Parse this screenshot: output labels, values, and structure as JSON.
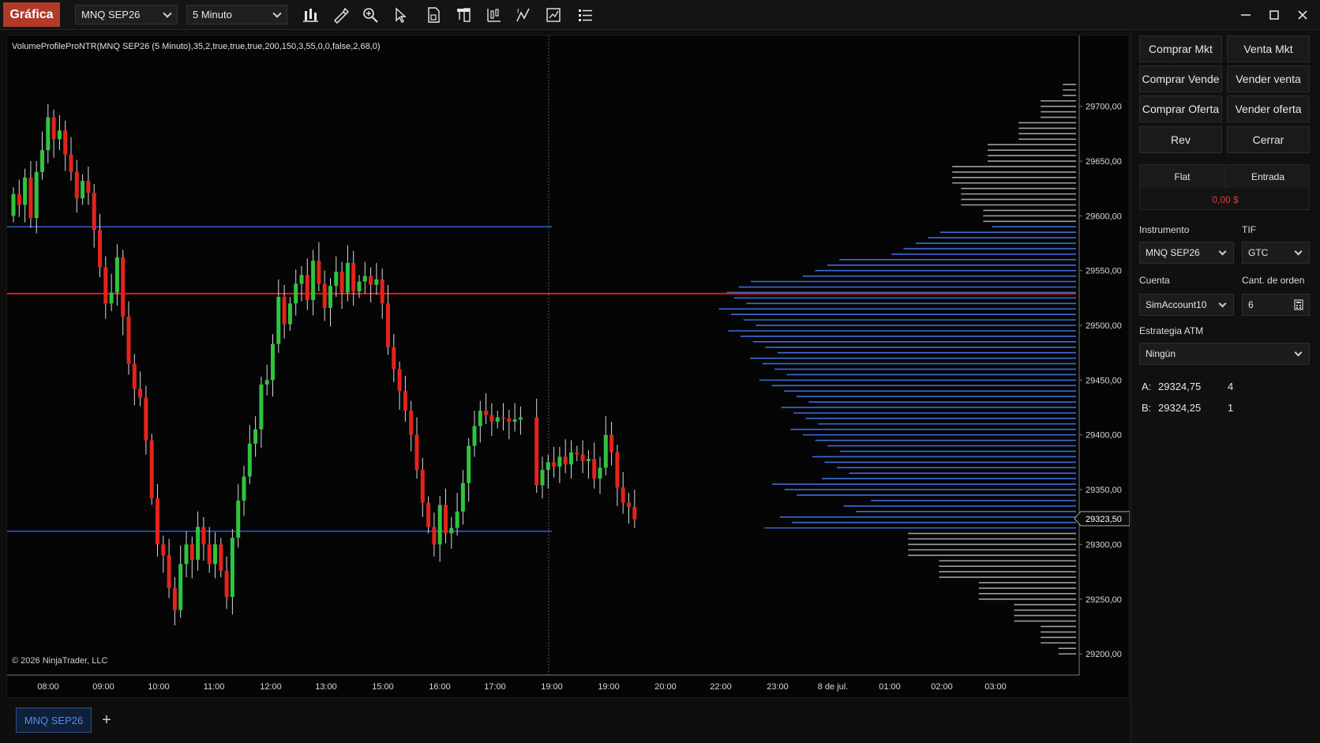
{
  "toolbar": {
    "app_label": "Gráfica",
    "instrument": "MNQ SEP26",
    "interval": "5 Minuto",
    "tools": [
      "bar-type-icon",
      "drawing-tools-icon",
      "zoom-icon",
      "pointer-icon",
      "data-box-icon",
      "chart-trader-icon",
      "properties-icon",
      "indicators-icon",
      "strategies-icon",
      "list-icon"
    ],
    "window_controls": [
      "minimize-icon",
      "maximize-icon",
      "close-icon"
    ]
  },
  "chart": {
    "indicator_label": "VolumeProfileProNTR(MNQ SEP26 (5 Minuto),35,2,true,true,true,200,150,3,55,0,0,false,2,68,0)",
    "copyright": "© 2026 NinjaTrader, LLC",
    "current_price_label": "29323,50",
    "colors": {
      "up": "#2fc43f",
      "down": "#e5231b",
      "value_area": "#3d6bd9",
      "outside_value": "#9e9e9e",
      "poc": "#e01b1b",
      "level": "#2d5fd1"
    }
  },
  "chart_data": {
    "type": "candlestick",
    "instrument": "MNQ SEP26",
    "interval": "5 Minuto",
    "x_ticks": [
      "08:00",
      "09:00",
      "10:00",
      "11:00",
      "12:00",
      "13:00",
      "15:00",
      "16:00",
      "17:00",
      "19:00",
      "19:00",
      "20:00",
      "22:00",
      "23:00",
      "8 de jul.",
      "01:00",
      "02:00",
      "03:00"
    ],
    "y_ticks": [
      "29700,00",
      "29650,00",
      "29600,00",
      "29550,00",
      "29500,00",
      "29450,00",
      "29400,00",
      "29350,00",
      "29300,00",
      "29250,00",
      "29200,00"
    ],
    "ylim": [
      29190,
      29725
    ],
    "poc_price": 29529,
    "value_area_high": 29590,
    "value_area_low": 29312,
    "last_price": 29323.5,
    "closes": [
      29620,
      29610,
      29635,
      29598,
      29640,
      29660,
      29690,
      29670,
      29678,
      29656,
      29640,
      29616,
      29632,
      29621,
      29587,
      29553,
      29520,
      29530,
      29562,
      29508,
      29465,
      29442,
      29434,
      29395,
      29342,
      29300,
      29290,
      29260,
      29240,
      29282,
      29300,
      29286,
      29316,
      29300,
      29282,
      29300,
      29276,
      29252,
      29306,
      29340,
      29362,
      29392,
      29405,
      29446,
      29450,
      29483,
      29526,
      29501,
      29520,
      29538,
      29546,
      29523,
      29559,
      29538,
      29516,
      29536,
      29549,
      29530,
      29557,
      29531,
      29540,
      29545,
      29537,
      29542,
      29520,
      29480,
      29460,
      29440,
      29422,
      29400,
      29368,
      29338,
      29316,
      29300,
      29336,
      29310,
      29315,
      29330,
      29356,
      29390,
      29408,
      29422,
      29418,
      29412,
      29416,
      29415,
      29412,
      29414,
      29416,
      29354,
      29368,
      29375,
      29371,
      29380,
      29373,
      29384,
      29382,
      29376,
      29378,
      29360,
      29370,
      29400,
      29384,
      29352,
      29338,
      29334,
      29323
    ],
    "profile_buckets_outside": [
      29720,
      29700,
      29680,
      29660,
      29640,
      29620,
      29600,
      29300,
      29280,
      29260,
      29240,
      29220,
      29200
    ],
    "profile_width_pct_outside": [
      5,
      10,
      15,
      22,
      30,
      28,
      23,
      40,
      33,
      24,
      16,
      10,
      6
    ],
    "profile_value_area_shape": {
      "poc_width_pct": 80,
      "va_high_width_pct": 22,
      "va_low_width_pct": 46
    }
  },
  "tab": {
    "label": "MNQ SEP26",
    "add_label": "+"
  },
  "panel": {
    "buy_market": "Comprar Mkt",
    "sell_market": "Venta Mkt",
    "buy_bid": "Comprar Vende",
    "sell_ask": "Vender venta",
    "buy_ask": "Comprar Oferta",
    "sell_bid": "Vender oferta",
    "reverse": "Rev",
    "close": "Cerrar",
    "position": "Flat",
    "entry": "Entrada",
    "pnl": "0,00 $",
    "instrument_label": "Instrumento",
    "instrument": "MNQ SEP26",
    "tif_label": "TIF",
    "tif": "GTC",
    "account_label": "Cuenta",
    "account": "SimAccount10",
    "qty_label": "Cant. de orden",
    "qty": "6",
    "atm_label": "Estrategia ATM",
    "atm": "Ningún",
    "ask_label": "A:",
    "ask_price": "29324,75",
    "ask_size": "4",
    "bid_label": "B:",
    "bid_price": "29324,25",
    "bid_size": "1"
  }
}
